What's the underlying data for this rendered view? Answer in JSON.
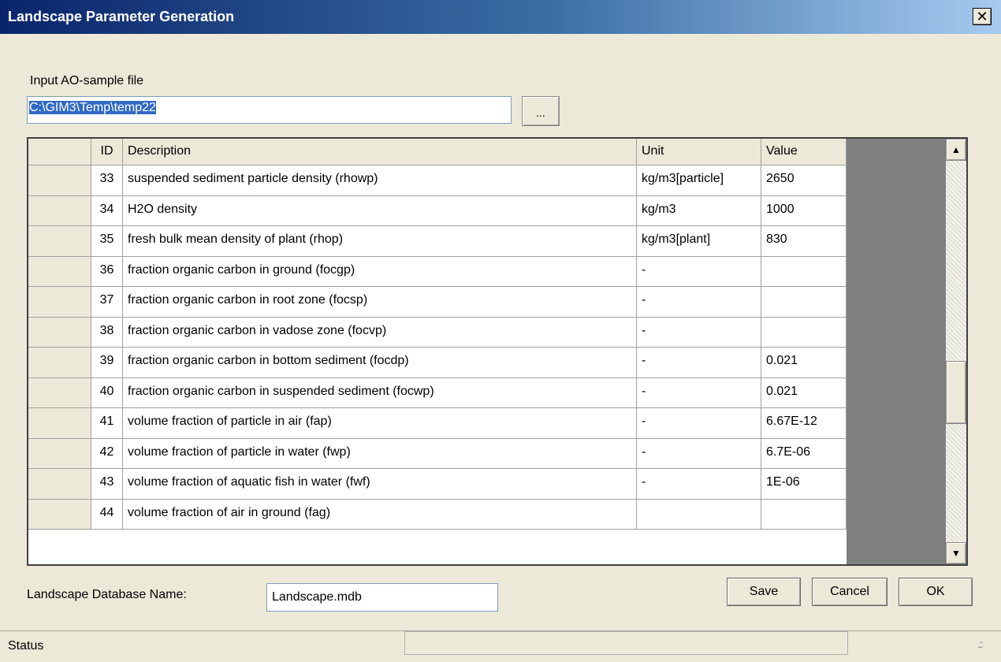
{
  "window": {
    "title": "Landscape Parameter Generation",
    "close_label": "✕"
  },
  "input": {
    "label": "Input AO-sample file",
    "value": "C:\\GIM3\\Temp\\temp22",
    "browse_label": "..."
  },
  "grid": {
    "headers": {
      "id": "ID",
      "description": "Description",
      "unit": "Unit",
      "value": "Value"
    },
    "rows": [
      {
        "id": "33",
        "description": "suspended sediment particle density (rhowp)",
        "unit": "kg/m3[particle]",
        "value": "2650"
      },
      {
        "id": "34",
        "description": "H2O density",
        "unit": "kg/m3",
        "value": "1000"
      },
      {
        "id": "35",
        "description": "fresh bulk mean density of plant (rhop)",
        "unit": "kg/m3[plant]",
        "value": "830"
      },
      {
        "id": "36",
        "description": "fraction organic carbon in ground (focgp)",
        "unit": "-",
        "value": ""
      },
      {
        "id": "37",
        "description": "fraction organic carbon in root zone (focsp)",
        "unit": "-",
        "value": ""
      },
      {
        "id": "38",
        "description": "fraction organic carbon in vadose zone (focvp)",
        "unit": "-",
        "value": ""
      },
      {
        "id": "39",
        "description": "fraction organic carbon in bottom sediment (focdp)",
        "unit": "-",
        "value": "0.021"
      },
      {
        "id": "40",
        "description": "fraction organic carbon in suspended sediment (focwp)",
        "unit": "-",
        "value": "0.021"
      },
      {
        "id": "41",
        "description": "volume fraction of particle in air (fap)",
        "unit": "-",
        "value": "6.67E-12"
      },
      {
        "id": "42",
        "description": "volume fraction of particle in water (fwp)",
        "unit": "-",
        "value": "6.7E-06"
      },
      {
        "id": "43",
        "description": "volume fraction of aquatic fish in water (fwf)",
        "unit": "-",
        "value": "1E-06"
      },
      {
        "id": "44",
        "description": "volume fraction of air in ground (fag)",
        "unit": "",
        "value": ""
      }
    ],
    "scroll_up_icon": "arrow-up-icon",
    "scroll_down_icon": "arrow-down-icon"
  },
  "database": {
    "label": "Landscape Database Name:",
    "value": "Landscape.mdb"
  },
  "buttons": {
    "save": "Save",
    "cancel": "Cancel",
    "ok": "OK"
  },
  "status": {
    "text": "Status",
    "grip": ".::"
  }
}
